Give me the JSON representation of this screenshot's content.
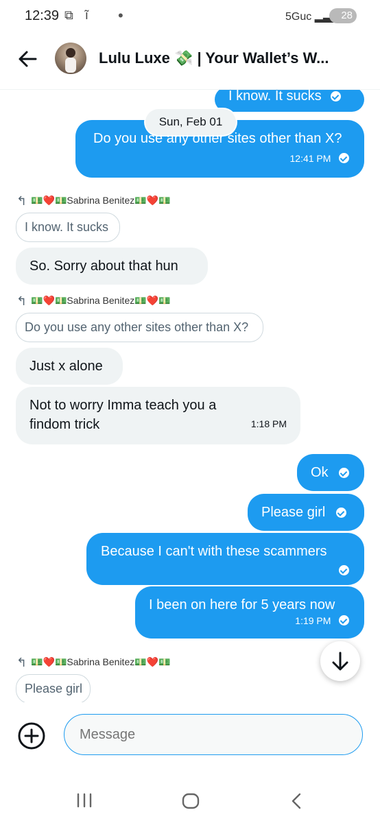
{
  "status_bar": {
    "time": "12:39",
    "network": "5Guc",
    "battery": "28"
  },
  "header": {
    "title": "Lulu Luxe 💸 | Your Wallet’s W..."
  },
  "date_separator": "Sun, Feb 01",
  "messages": {
    "m0": {
      "text": "I know. It sucks"
    },
    "m1": {
      "text": "Do you use any other sites other than X?",
      "time": "12:41 PM"
    },
    "r1": {
      "label": "💵❤️💵Sabrina Benitez💵❤️💵",
      "quote": "I know. It sucks"
    },
    "m2": {
      "text": "So. Sorry about that hun"
    },
    "r2": {
      "label": "💵❤️💵Sabrina Benitez💵❤️💵",
      "quote": "Do you use any other sites other than X?"
    },
    "m3": {
      "text": "Just x alone"
    },
    "m4": {
      "text": "Not to worry Imma teach you a findom trick",
      "time": "1:18 PM"
    },
    "m5": {
      "text": "Ok"
    },
    "m6": {
      "text": "Please girl"
    },
    "m7": {
      "text": "Because I can't with these scammers"
    },
    "m8": {
      "text": "I been on here for 5 years now",
      "time": "1:19 PM"
    },
    "r3": {
      "label": "💵❤️💵Sabrina Benitez💵❤️💵",
      "quote": "Please girl"
    }
  },
  "composer": {
    "placeholder": "Message"
  },
  "colors": {
    "accent": "#1d9bf0",
    "incoming_bg": "#eff3f4"
  },
  "icons": [
    "back-arrow-icon",
    "add-circle-icon",
    "arrow-down-icon",
    "reply-icon",
    "recents-icon",
    "home-icon",
    "nav-back-icon"
  ]
}
